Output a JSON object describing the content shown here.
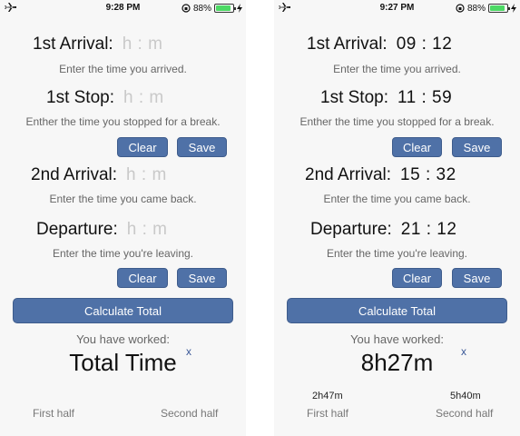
{
  "screens": [
    {
      "status": {
        "time": "9:28 PM",
        "battery": "88%",
        "battery_level": 0.88
      },
      "rows": {
        "first_arrival": {
          "label": "1st  Arrival:",
          "value": "h : m",
          "hint": "Enter the time you arrived."
        },
        "first_stop": {
          "label": "1st Stop:",
          "value": "h : m",
          "hint": "Enther the time you stopped for a break."
        },
        "second_arrival": {
          "label": "2nd Arrival:",
          "value": "h : m",
          "hint": "Enter the time you came back."
        },
        "departure": {
          "label": "Departure:",
          "value": "h : m",
          "hint": "Enter the time you're leaving."
        }
      },
      "buttons": {
        "clear": "Clear",
        "save": "Save",
        "calculate": "Calculate Total"
      },
      "result": {
        "worked_label": "You have worked:",
        "total": "Total Time",
        "close": "x"
      },
      "halves": {
        "first_value": "",
        "second_value": "",
        "first_label": "First half",
        "second_label": "Second half"
      }
    },
    {
      "status": {
        "time": "9:27 PM",
        "battery": "88%",
        "battery_level": 0.88
      },
      "rows": {
        "first_arrival": {
          "label": "1st  Arrival:",
          "value": "09 : 12",
          "hint": "Enter the time you arrived."
        },
        "first_stop": {
          "label": "1st Stop:",
          "value": "11 : 59",
          "hint": "Enther the time you stopped for a break."
        },
        "second_arrival": {
          "label": "2nd Arrival:",
          "value": "15 : 32",
          "hint": "Enter the time you came back."
        },
        "departure": {
          "label": "Departure:",
          "value": "21 : 12",
          "hint": "Enter the time you're leaving."
        }
      },
      "buttons": {
        "clear": "Clear",
        "save": "Save",
        "calculate": "Calculate Total"
      },
      "result": {
        "worked_label": "You have worked:",
        "total": "8h27m",
        "close": "x"
      },
      "halves": {
        "first_value": "2h47m",
        "second_value": "5h40m",
        "first_label": "First half",
        "second_label": "Second half"
      }
    }
  ]
}
